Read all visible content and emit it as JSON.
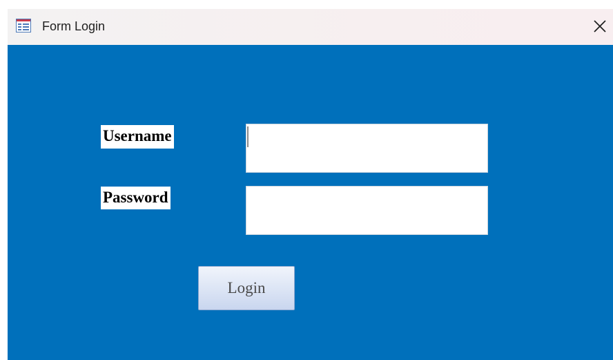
{
  "window": {
    "title": "Form Login",
    "title_icon": "form-icon",
    "close_glyph": "✕",
    "close_icon": "close-icon"
  },
  "form": {
    "username_label": "Username",
    "username_value": "",
    "password_label": "Password",
    "password_value": "",
    "login_label": "Login"
  },
  "colors": {
    "form_background": "#0070bb",
    "titlebar_background": "#f5f0f1",
    "button_gradient_top": "#f0f4fb",
    "button_gradient_bottom": "#c9d6ef"
  }
}
